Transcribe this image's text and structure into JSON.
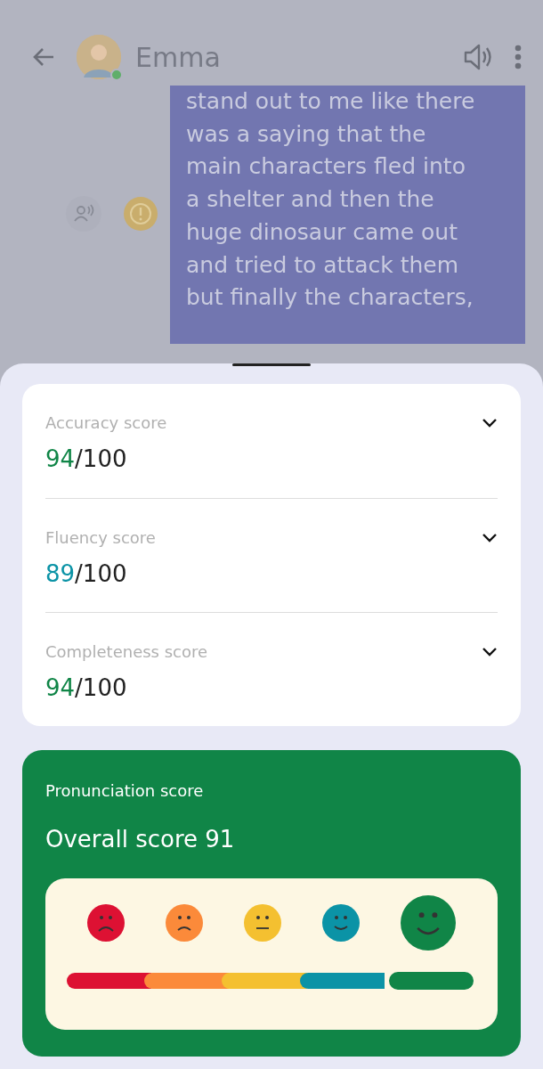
{
  "chat": {
    "contact": {
      "name": "Emma",
      "online": true
    },
    "message": {
      "lines": [
        "stand out to me like there",
        "was a saying that the",
        "main characters fled into",
        "a shelter and then the",
        "huge dinosaur came out",
        "and tried to attack them",
        "but finally the characters,"
      ]
    }
  },
  "scores": [
    {
      "label": "Accuracy score",
      "value": "94",
      "total": "/100",
      "color": "#108547",
      "expanded": false
    },
    {
      "label": "Fluency score",
      "value": "89",
      "total": "/100",
      "color": "#0b93a6",
      "expanded": false
    },
    {
      "label": "Completeness score",
      "value": "94",
      "total": "/100",
      "color": "#108547",
      "expanded": false
    }
  ],
  "pronunciation": {
    "title": "Pronunciation score",
    "overall": "Overall score 91",
    "levels": [
      {
        "kind": "sad",
        "color": "#dd1133",
        "selected": false
      },
      {
        "kind": "frown",
        "color": "#fb8a3a",
        "selected": false
      },
      {
        "kind": "neutral",
        "color": "#f4c030",
        "selected": false
      },
      {
        "kind": "smile",
        "color": "#0b93a6",
        "selected": false
      },
      {
        "kind": "happy",
        "color": "#108547",
        "selected": true
      }
    ]
  }
}
